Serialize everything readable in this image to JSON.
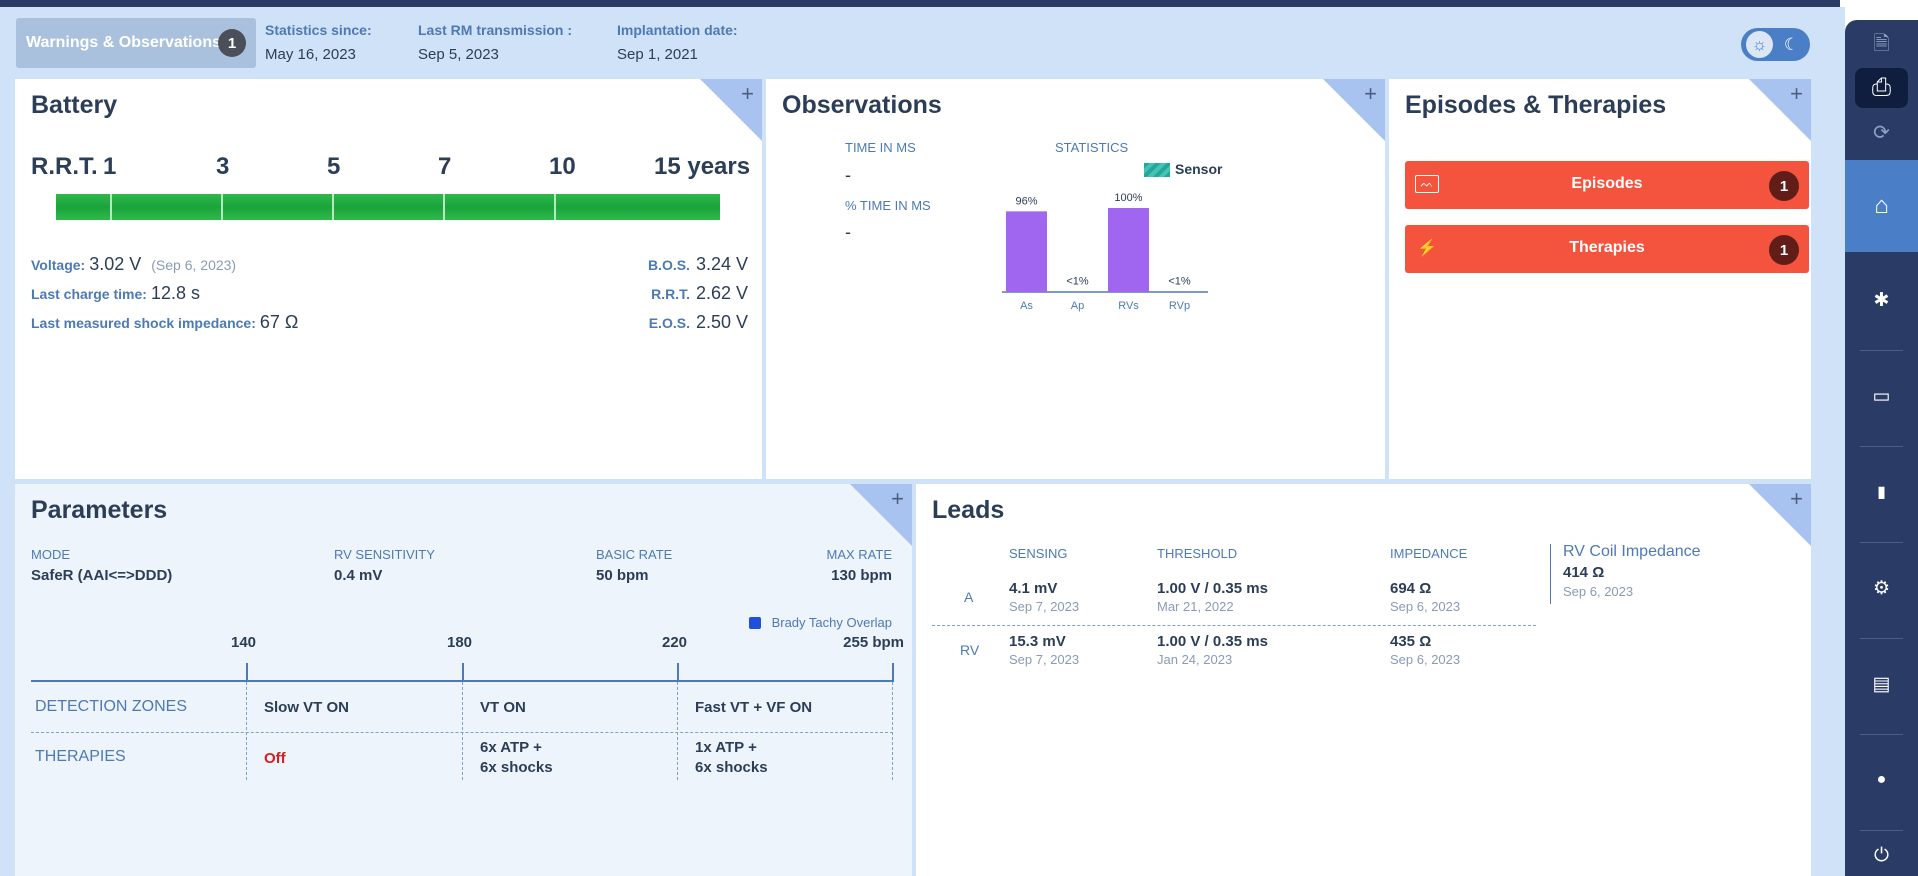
{
  "header": {
    "warnings_label": "Warnings & Observations",
    "warnings_count": "1",
    "items": [
      {
        "key": "Statistics since:",
        "value": "May 16, 2023"
      },
      {
        "key": "Last RM transmission :",
        "value": "Sep 5, 2023"
      },
      {
        "key": "Implantation date:",
        "value": "Sep 1, 2021"
      }
    ],
    "theme": {
      "light_icon": "sun-icon",
      "dark_icon": "moon-icon",
      "light_glyph": "☼",
      "dark_glyph": "☾"
    }
  },
  "battery": {
    "title": "Battery",
    "rrt_prefix": "R.R.T.",
    "scale": [
      "1",
      "3",
      "5",
      "7",
      "10",
      "15 years"
    ],
    "voltage_label": "Voltage:",
    "voltage_value": "3.02 V",
    "voltage_date": "(Sep 6, 2023)",
    "charge_label": "Last charge time:",
    "charge_value": "12.8 s",
    "impedance_label": "Last measured shock impedance:",
    "impedance_value": "67 Ω",
    "bos_label": "B.O.S.",
    "bos_value": "3.24 V",
    "rrt_label": "R.R.T.",
    "rrt_value": "2.62 V",
    "eos_label": "E.O.S.",
    "eos_value": "2.50 V",
    "bar_color": "#19a33a"
  },
  "observations": {
    "title": "Observations",
    "time_in_ms_label": "TIME IN MS",
    "time_in_ms_value": "-",
    "pct_time_in_ms_label": "% TIME IN MS",
    "pct_time_in_ms_value": "-",
    "statistics_label": "STATISTICS",
    "chart_data": {
      "type": "bar",
      "legend": "Sensor",
      "categories": [
        "As",
        "Ap",
        "RVs",
        "RVp"
      ],
      "values": [
        96,
        0.5,
        100,
        0.5
      ],
      "data_labels": [
        "96%",
        "<1%",
        "100%",
        "<1%"
      ],
      "ylim": [
        0,
        100
      ],
      "bar_color": "#a066f0",
      "legend_color": "#1fa89b"
    }
  },
  "episodes": {
    "title": "Episodes & Therapies",
    "buttons": [
      {
        "label": "Episodes",
        "count": "1",
        "icon": "ecg-icon",
        "glyph": "ᨓ"
      },
      {
        "label": "Therapies",
        "count": "1",
        "icon": "lightning-icon",
        "glyph": "⚡"
      }
    ],
    "button_color": "#f4533e"
  },
  "parameters": {
    "title": "Parameters",
    "fields": [
      {
        "key": "MODE",
        "value": "SafeR (AAI<=>DDD)"
      },
      {
        "key": "RV SENSITIVITY",
        "value": "0.4 mV"
      },
      {
        "key": "BASIC RATE",
        "value": "50 bpm"
      },
      {
        "key": "MAX RATE",
        "value": "130 bpm"
      }
    ],
    "overlap_legend": "Brady Tachy Overlap",
    "scale": [
      "140",
      "180",
      "220",
      "255 bpm"
    ],
    "detection_label": "DETECTION ZONES",
    "therapies_label": "THERAPIES",
    "zones": [
      {
        "detection": "Slow VT ON",
        "therapy_line1": "Off",
        "therapy_line2": ""
      },
      {
        "detection": "VT ON",
        "therapy_line1": "6x ATP  +",
        "therapy_line2": "6x shocks"
      },
      {
        "detection": "Fast VT + VF ON",
        "therapy_line1": "1x ATP  +",
        "therapy_line2": "6x shocks"
      }
    ]
  },
  "leads": {
    "title": "Leads",
    "columns": [
      "SENSING",
      "THRESHOLD",
      "IMPEDANCE"
    ],
    "rows": [
      {
        "label": "A",
        "sensing": "4.1 mV",
        "sensing_date": "Sep 7, 2023",
        "threshold": "1.00 V / 0.35 ms",
        "threshold_date": "Mar 21, 2022",
        "impedance": "694 Ω",
        "impedance_date": "Sep 6, 2023"
      },
      {
        "label": "RV",
        "sensing": "15.3 mV",
        "sensing_date": "Sep 7, 2023",
        "threshold": "1.00 V / 0.35 ms",
        "threshold_date": "Jan 24, 2023",
        "impedance": "435 Ω",
        "impedance_date": "Sep 6, 2023"
      }
    ],
    "coil_title": "RV Coil Impedance",
    "coil_value": "414 Ω",
    "coil_date": "Sep 6, 2023"
  },
  "sidebar": {
    "top": [
      {
        "name": "document-icon",
        "glyph": "🗎"
      },
      {
        "name": "printer-icon",
        "glyph": "⎙"
      },
      {
        "name": "sync-icon",
        "glyph": "⟳"
      }
    ],
    "items": [
      {
        "name": "home-icon",
        "glyph": "⌂"
      },
      {
        "name": "pills-icon",
        "glyph": "✱"
      },
      {
        "name": "monitor-ecg-icon",
        "glyph": "▭"
      },
      {
        "name": "chart-icon",
        "glyph": "▮"
      },
      {
        "name": "gear-icon",
        "glyph": "⚙"
      },
      {
        "name": "clipboard-icon",
        "glyph": "▤"
      },
      {
        "name": "user-icon",
        "glyph": "●"
      },
      {
        "name": "power-icon",
        "glyph": "⏻"
      }
    ],
    "active_color": "#4a7fc7"
  }
}
